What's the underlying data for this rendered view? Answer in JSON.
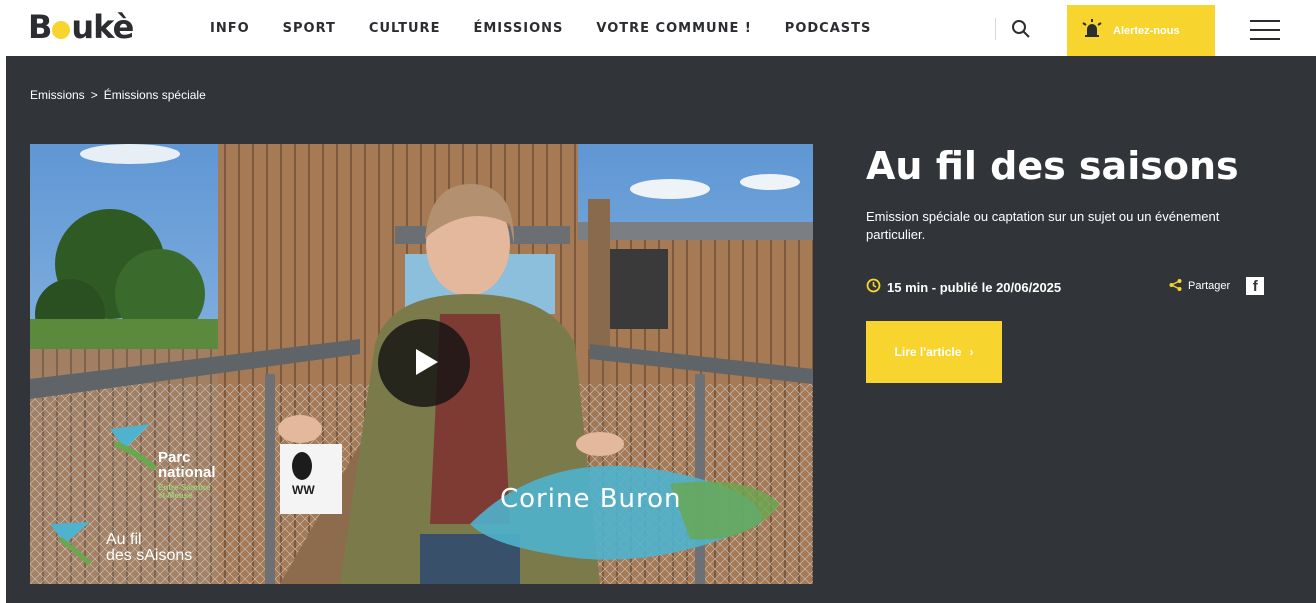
{
  "brand": {
    "logo_left": "B",
    "logo_right": "ukè",
    "accent": "#f7d52e",
    "dark": "#313539"
  },
  "nav": {
    "items": [
      "INFO",
      "SPORT",
      "CULTURE",
      "ÉMISSIONS",
      "VOTRE COMMUNE !",
      "PODCASTS"
    ]
  },
  "header": {
    "search_icon": "search-icon",
    "alert_label": "Alertez-nous",
    "alert_icon": "alarm-light-icon",
    "menu_icon": "hamburger-icon"
  },
  "breadcrumb": {
    "item1": "Emissions",
    "separator": ">",
    "item2": "Émissions spéciale"
  },
  "article": {
    "title": "Au fil des saisons",
    "description": "Emission spéciale ou captation sur un sujet ou un événement particulier.",
    "duration_and_date": "15 min - publié le 20/06/2025",
    "share_label": "Partager",
    "read_label": "Lire l'article"
  },
  "video": {
    "presenter_name": "Corine Buron",
    "park_logo": [
      "Parc",
      "national"
    ],
    "park_sub": [
      "Entre-Sambre",
      "et-Meuse"
    ],
    "show_logo": [
      "Au fil",
      "des sAisons"
    ],
    "wwf": "WW"
  }
}
